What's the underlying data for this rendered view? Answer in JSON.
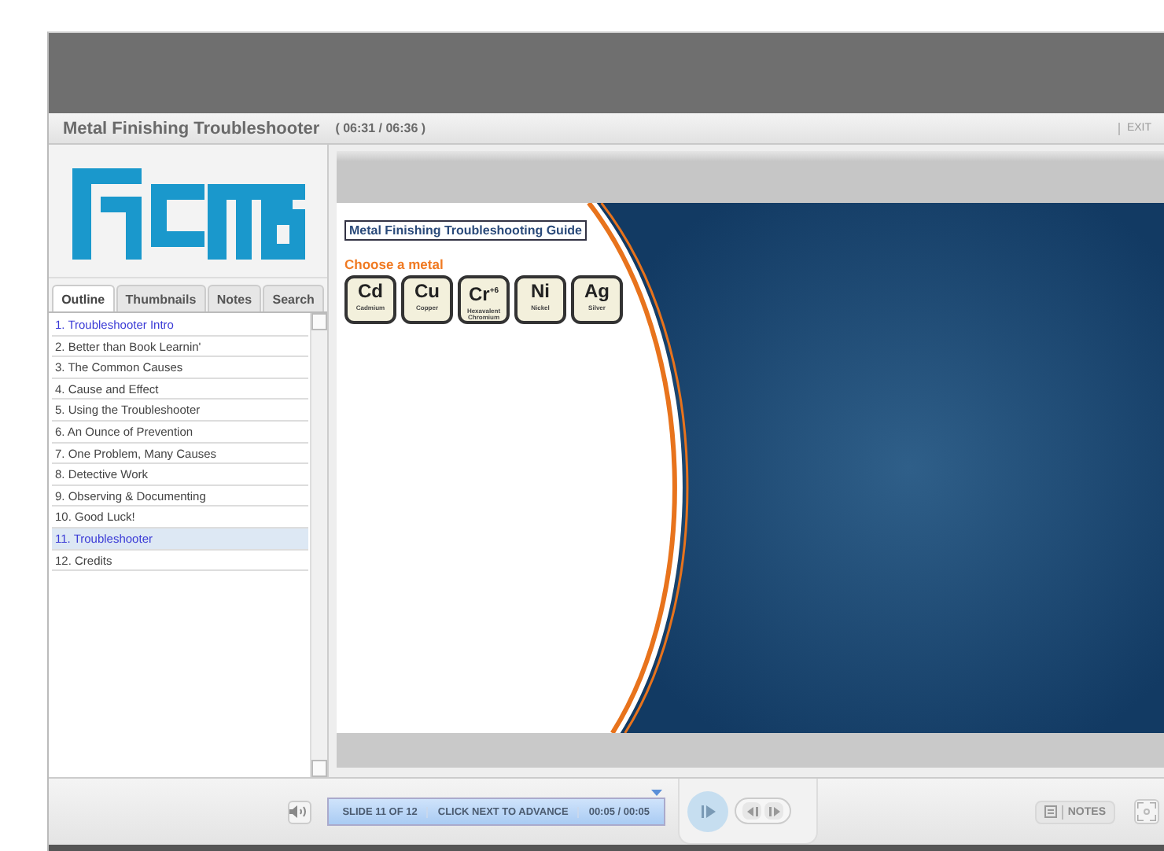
{
  "window": {
    "title": "Metal Finishing Troubleshooter",
    "elapsed": "( 06:31 / 06:36 )",
    "exit": "EXIT"
  },
  "tabs": [
    {
      "label": "Outline",
      "selected": true
    },
    {
      "label": "Thumbnails",
      "selected": false
    },
    {
      "label": "Notes",
      "selected": false
    },
    {
      "label": "Search",
      "selected": false
    }
  ],
  "outline": [
    {
      "label": "1. Troubleshooter Intro",
      "visited": true,
      "selected": false
    },
    {
      "label": "2. Better than Book Learnin'",
      "visited": false,
      "selected": false
    },
    {
      "label": "3. The Common Causes",
      "visited": false,
      "selected": false
    },
    {
      "label": "4. Cause and Effect",
      "visited": false,
      "selected": false
    },
    {
      "label": "5. Using the Troubleshooter",
      "visited": false,
      "selected": false
    },
    {
      "label": "6. An Ounce of Prevention",
      "visited": false,
      "selected": false
    },
    {
      "label": "7. One Problem, Many Causes",
      "visited": false,
      "selected": false
    },
    {
      "label": "8. Detective Work",
      "visited": false,
      "selected": false
    },
    {
      "label": "9. Observing & Documenting",
      "visited": false,
      "selected": false
    },
    {
      "label": "10. Good Luck!",
      "visited": false,
      "selected": false
    },
    {
      "label": "11. Troubleshooter",
      "visited": true,
      "selected": true
    },
    {
      "label": "12. Credits",
      "visited": false,
      "selected": false
    }
  ],
  "slide": {
    "title": "Metal Finishing Troubleshooting Guide",
    "prompt": "Choose a metal",
    "metals": [
      {
        "symbol": "Cd",
        "name": "Cadmium"
      },
      {
        "symbol": "Cu",
        "name": "Copper"
      },
      {
        "symbol": "Cr$^{+6}$",
        "name": "Hexavalent Chromium"
      },
      {
        "symbol": "Ni",
        "name": "Nickel"
      },
      {
        "symbol": "Ag",
        "name": "Silver"
      }
    ]
  },
  "controls": {
    "slide_counter": "SLIDE 11 OF 12",
    "message": "CLICK NEXT TO ADVANCE",
    "time": "00:05 / 00:05",
    "notes": "NOTES"
  }
}
